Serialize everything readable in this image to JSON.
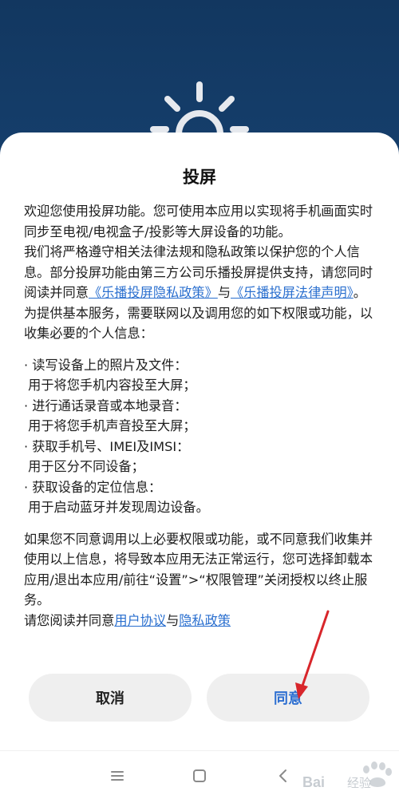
{
  "dialog": {
    "title": "投屏",
    "para1": "欢迎您使用投屏功能。您可使用本应用以实现将手机画面实时同步至电视/电视盒子/投影等大屏设备的功能。",
    "para2": "我们将严格遵守相关法律法规和隐私政策以保护您的个人信息。部分投屏功能由第三方公司乐播投屏提供支持，请您同时阅读并同意",
    "link_privacy": "《乐播投屏隐私政策》",
    "para2_and": "与",
    "link_legal": "《乐播投屏法律声明》",
    "para2_end": "。",
    "para3": "为提供基本服务，需要联网以及调用您的如下权限或功能，以收集必要的个人信息：",
    "permissions": [
      {
        "title": "· 读写设备上的照片及文件：",
        "desc": "用于将您手机内容投至大屏；"
      },
      {
        "title": "· 进行通话录音或本地录音：",
        "desc": "用于将您手机声音投至大屏；"
      },
      {
        "title": "· 获取手机号、IMEI及IMSI：",
        "desc": "用于区分不同设备；"
      },
      {
        "title": "· 获取设备的定位信息：",
        "desc": "用于启动蓝牙并发现周边设备。"
      }
    ],
    "para4": "如果您不同意调用以上必要权限或功能，或不同意我们收集并使用以上信息，将导致本应用无法正常运行，您可选择卸载本应用/退出本应用/前往“设置”>“权限管理”关闭授权以终止服务。",
    "para5_prefix": "请您阅读并同意",
    "link_user": "用户协议",
    "para5_and": "与",
    "link_policy": "隐私政策",
    "cancel_label": "取消",
    "agree_label": "同意"
  },
  "colors": {
    "background": "#14375e",
    "link": "#2a6fcf",
    "agree_text": "#2d6fd1",
    "button_bg": "#efefef",
    "arrow": "#d8262b"
  },
  "icons": {
    "top": "sun-icon",
    "nav": [
      "menu-icon",
      "home-icon",
      "back-icon"
    ]
  },
  "watermark": "Baidu经验"
}
